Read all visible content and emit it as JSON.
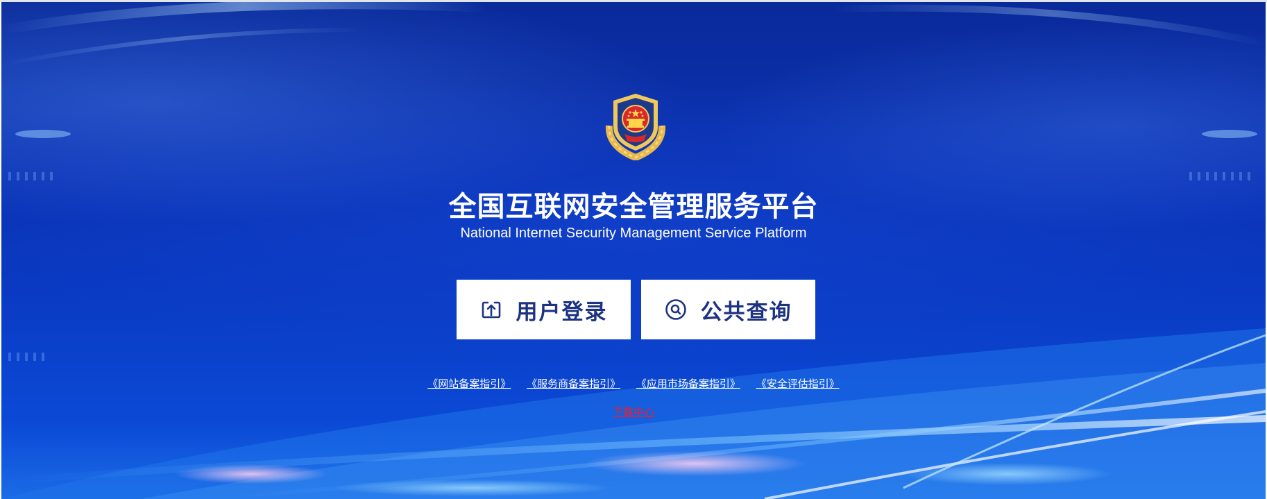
{
  "header": {
    "title_cn": "全国互联网安全管理服务平台",
    "title_en": "National Internet Security Management Service Platform"
  },
  "actions": {
    "login_label": "用户登录",
    "query_label": "公共查询",
    "login_icon": "upload-box-icon",
    "query_icon": "search-circle-icon"
  },
  "guide_links": [
    "《网站备案指引》",
    "《服务商备案指引》",
    "《应用市场备案指引》",
    "《安全评估指引》"
  ],
  "download_label": "下载中心",
  "colors": {
    "background": "#0b32b4",
    "button_text": "#1c3382",
    "download_link": "#ff1a1a"
  }
}
